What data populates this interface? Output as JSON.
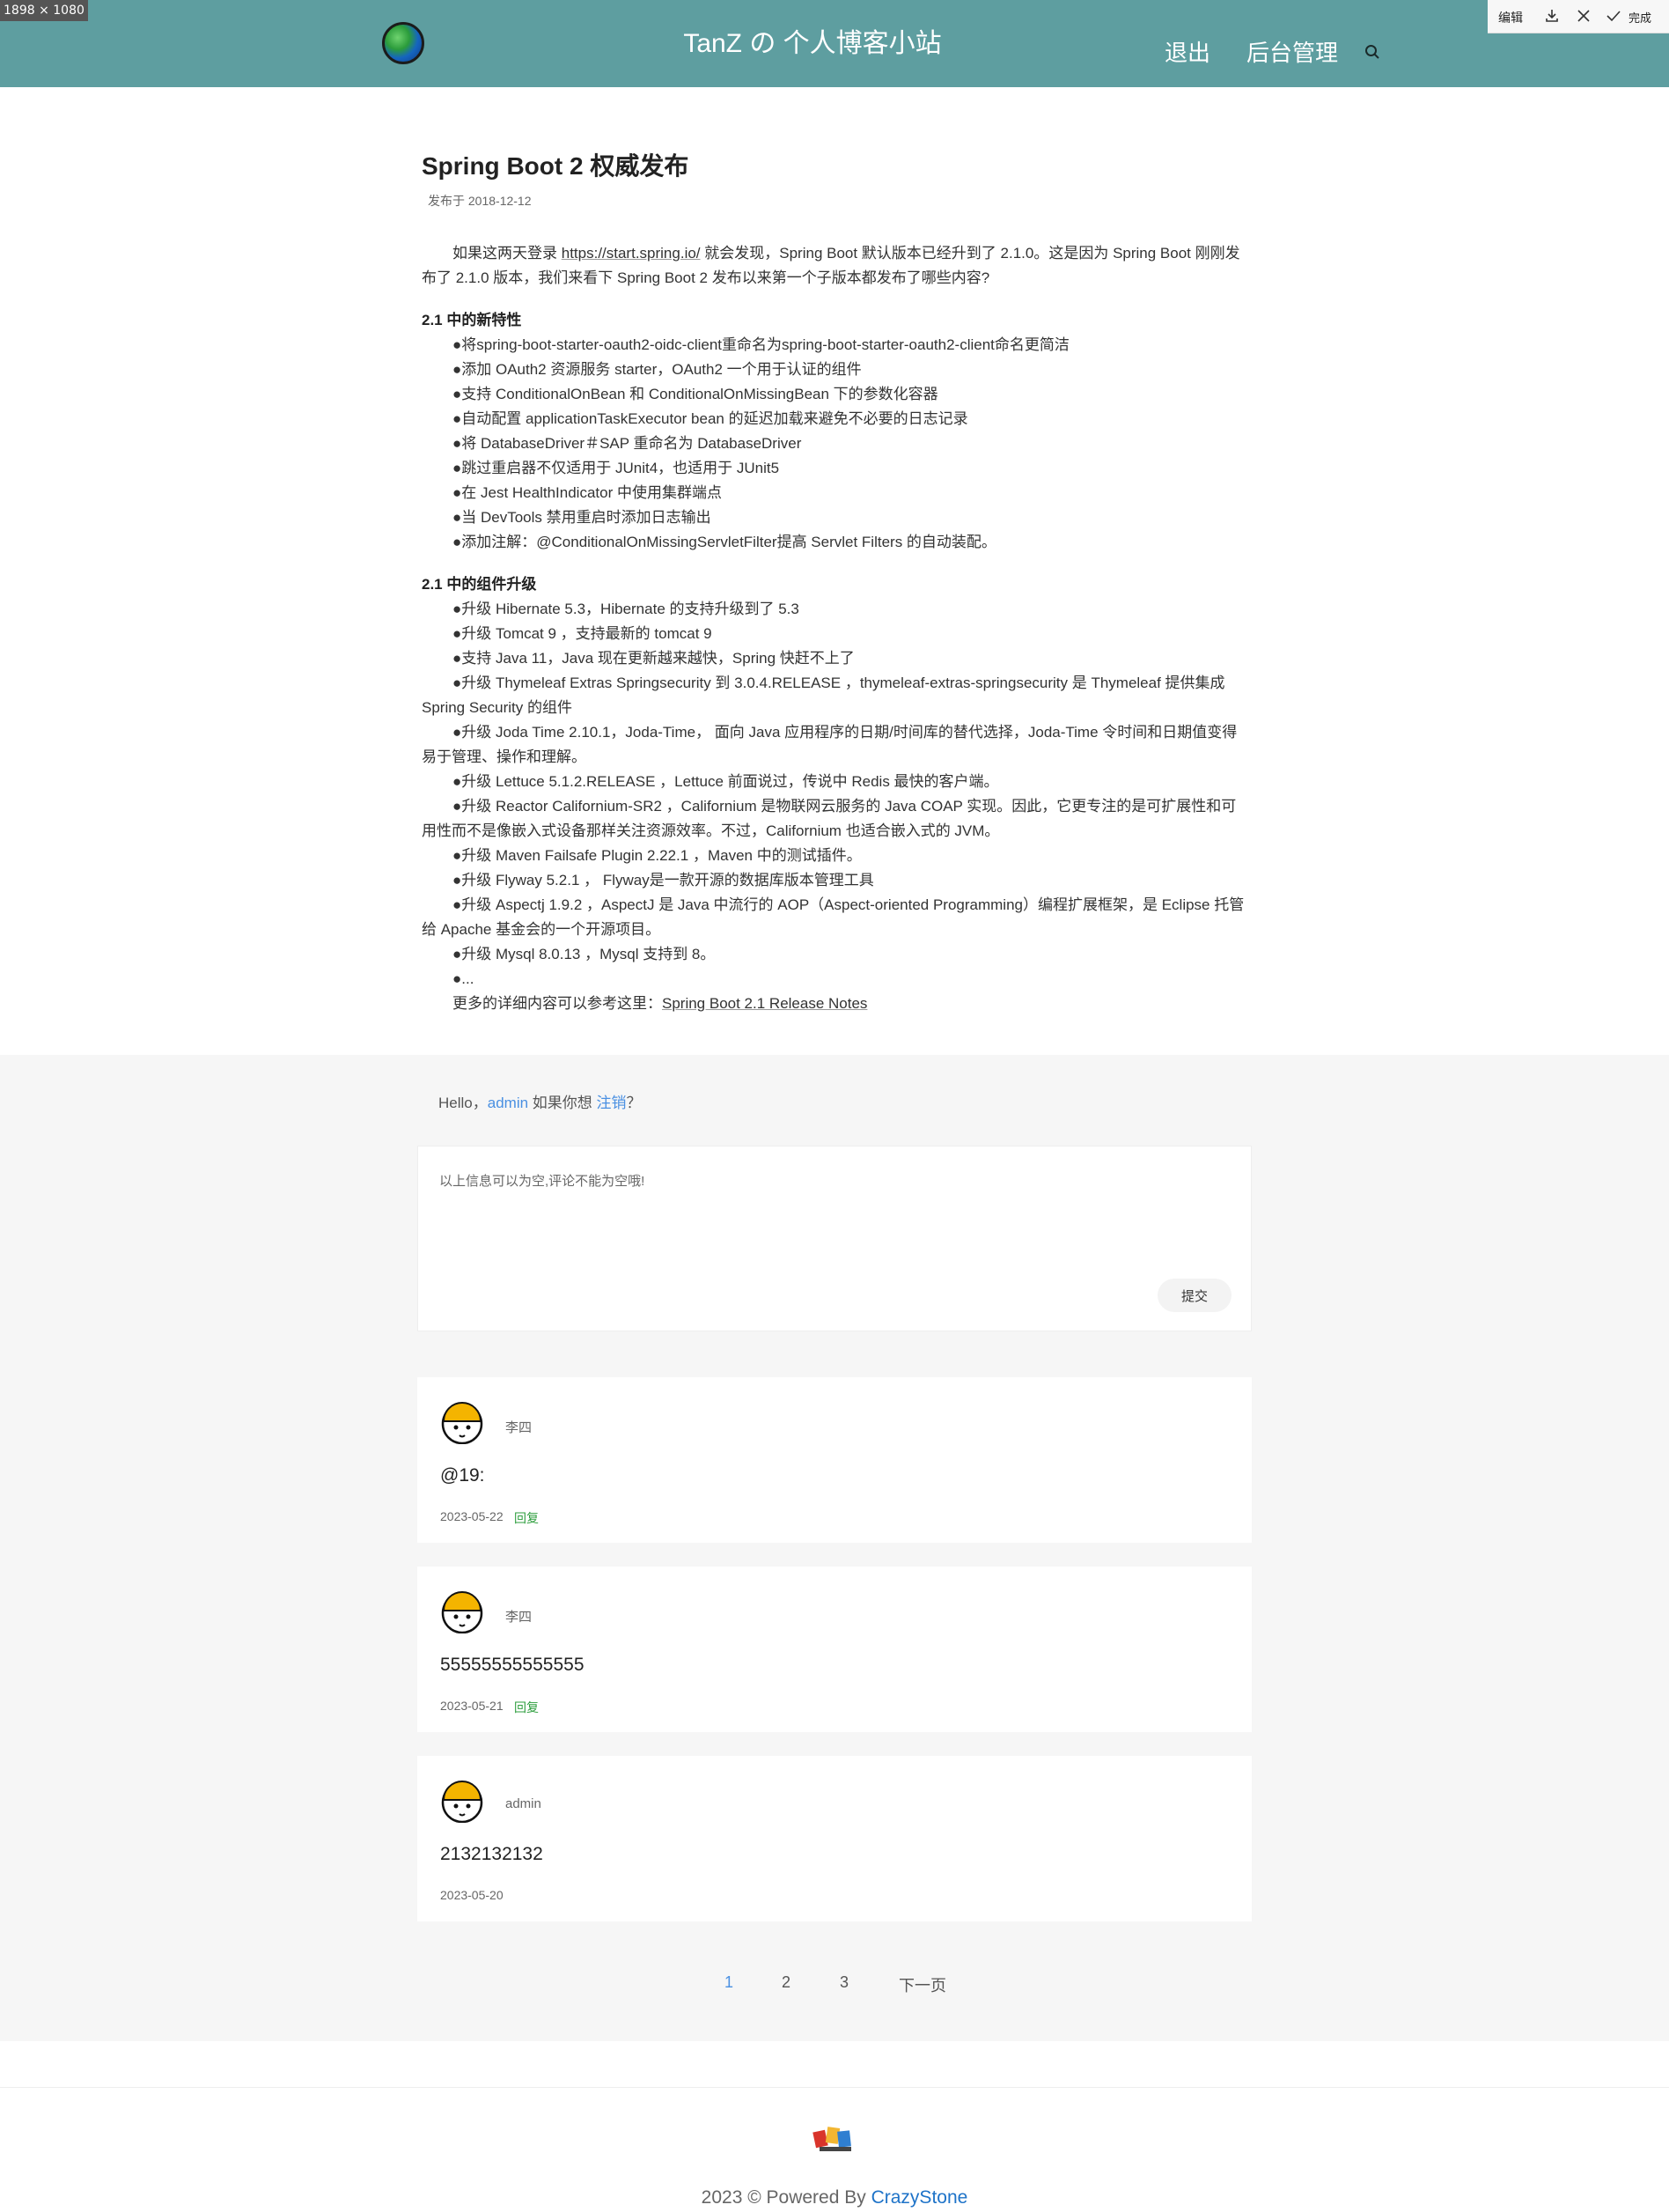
{
  "screenshot_badge": "1898 × 1080",
  "toolbar": {
    "edit": "编辑",
    "done": "完成"
  },
  "header": {
    "site_title": "TanZ の 个人博客小站",
    "nav": {
      "logout": "退出",
      "admin": "后台管理"
    }
  },
  "article": {
    "title": "Spring Boot 2 权威发布",
    "date": "发布于 2018-12-12",
    "intro_before": "如果这两天登录 ",
    "intro_link": "https://start.spring.io/",
    "intro_after": " 就会发现，Spring Boot 默认版本已经升到了 2.1.0。这是因为 Spring Boot 刚刚发布了 2.1.0 版本，我们来看下 Spring Boot 2 发布以来第一个子版本都发布了哪些内容?",
    "section1_title": "2.1 中的新特性",
    "section1_items": [
      "●将spring-boot-starter-oauth2-oidc-client重命名为spring-boot-starter-oauth2-client命名更简洁",
      "●添加 OAuth2 资源服务 starter，OAuth2 一个用于认证的组件",
      "●支持 ConditionalOnBean 和 ConditionalOnMissingBean 下的参数化容器",
      "●自动配置 applicationTaskExecutor bean 的延迟加载来避免不必要的日志记录",
      "●将 DatabaseDriver＃SAP 重命名为 DatabaseDriver",
      "●跳过重启器不仅适用于 JUnit4，也适用于 JUnit5",
      "●在 Jest HealthIndicator 中使用集群端点",
      "●当 DevTools 禁用重启时添加日志输出",
      "●添加注解：@ConditionalOnMissingServletFilter提高 Servlet Filters 的自动装配。"
    ],
    "section2_title": "2.1 中的组件升级",
    "section2_items": [
      "●升级 Hibernate 5.3，Hibernate 的支持升级到了 5.3",
      "●升级 Tomcat 9 ，支持最新的 tomcat 9",
      "●支持 Java 11，Java 现在更新越来越快，Spring 快赶不上了",
      "●升级 Thymeleaf Extras Springsecurity 到 3.0.4.RELEASE ，thymeleaf-extras-springsecurity 是 Thymeleaf 提供集成 Spring Security 的组件",
      "●升级 Joda Time 2.10.1，Joda-Time， 面向 Java 应用程序的日期/时间库的替代选择，Joda-Time 令时间和日期值变得易于管理、操作和理解。",
      "●升级 Lettuce 5.1.2.RELEASE ，Lettuce 前面说过，传说中 Redis 最快的客户端。",
      "●升级 Reactor Californium-SR2 ，Californium 是物联网云服务的 Java COAP 实现。因此，它更专注的是可扩展性和可用性而不是像嵌入式设备那样关注资源效率。不过，Californium 也适合嵌入式的 JVM。",
      "●升级 Maven Failsafe Plugin 2.22.1 ，Maven 中的测试插件。",
      "●升级 Flyway 5.2.1 ， Flyway是一款开源的数据库版本管理工具",
      "●升级 Aspectj 1.9.2 ，AspectJ 是 Java 中流行的 AOP（Aspect-oriented Programming）编程扩展框架，是 Eclipse 托管给 Apache 基金会的一个开源项目。",
      "●升级 Mysql 8.0.13 ，Mysql 支持到 8。",
      "●..."
    ],
    "more_before": "更多的详细内容可以参考这里：",
    "more_link": "Spring Boot 2.1 Release Notes"
  },
  "comment_form": {
    "hello": "Hello，",
    "user": "admin",
    "if_want": " 如果你想 ",
    "logout": "注销",
    "question": "？",
    "placeholder": "以上信息可以为空,评论不能为空哦!",
    "submit": "提交"
  },
  "comments": [
    {
      "user": "李四",
      "text": "@19:",
      "date": "2023-05-22",
      "reply": "回复"
    },
    {
      "user": "李四",
      "text": "55555555555555",
      "date": "2023-05-21",
      "reply": "回复"
    },
    {
      "user": "admin",
      "text": "2132132132",
      "date": "2023-05-20"
    }
  ],
  "pagination": {
    "pages": [
      "1",
      "2",
      "3"
    ],
    "next": "下一页",
    "current": "1"
  },
  "footer": {
    "copyright": "2023 © Powered By ",
    "brand": "CrazyStone"
  }
}
